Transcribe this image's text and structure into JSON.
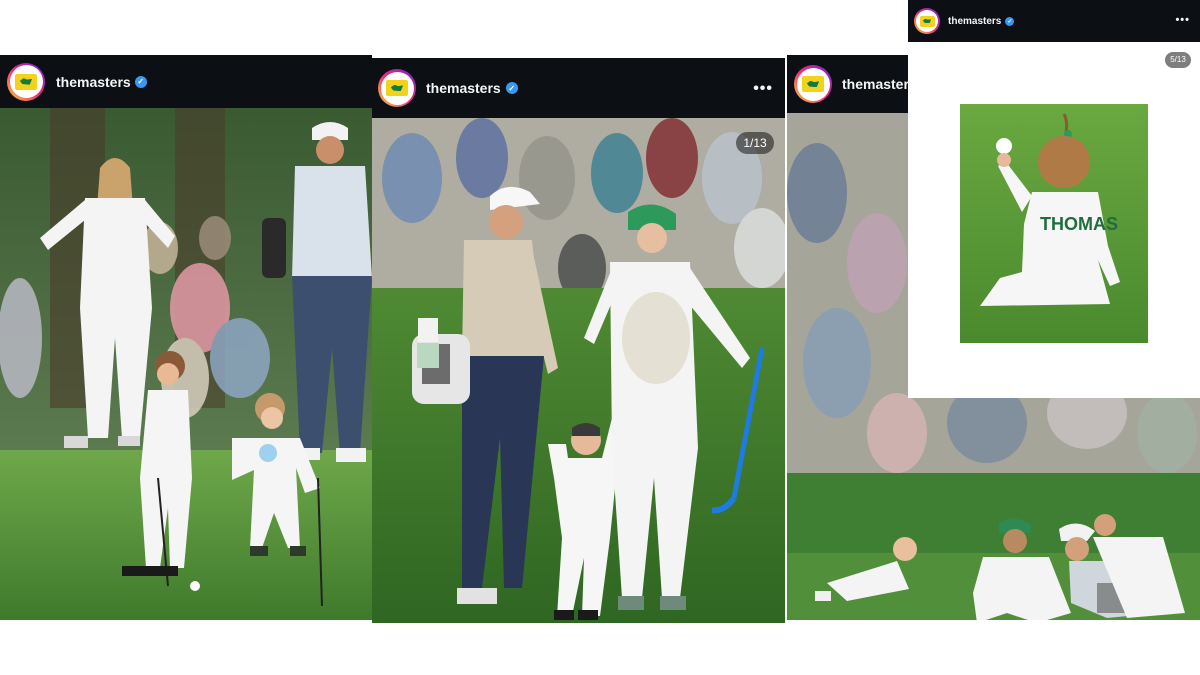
{
  "posts": [
    {
      "username": "themasters",
      "verified": true
    },
    {
      "username": "themasters",
      "verified": true,
      "more_icon": "more-horizontal-icon",
      "counter": "1/13"
    },
    {
      "username": "themasters",
      "verified": true
    },
    {
      "username": "themasters",
      "verified": true,
      "more_icon": "more-horizontal-icon",
      "counter": "5/13",
      "jersey_name": "THOMAS"
    }
  ],
  "colors": {
    "header_bg": "#0c1014",
    "verified_blue": "#3897f0",
    "grass": "#5f9a3a",
    "masters_green": "#117a3c",
    "masters_yellow": "#f2d21a"
  }
}
